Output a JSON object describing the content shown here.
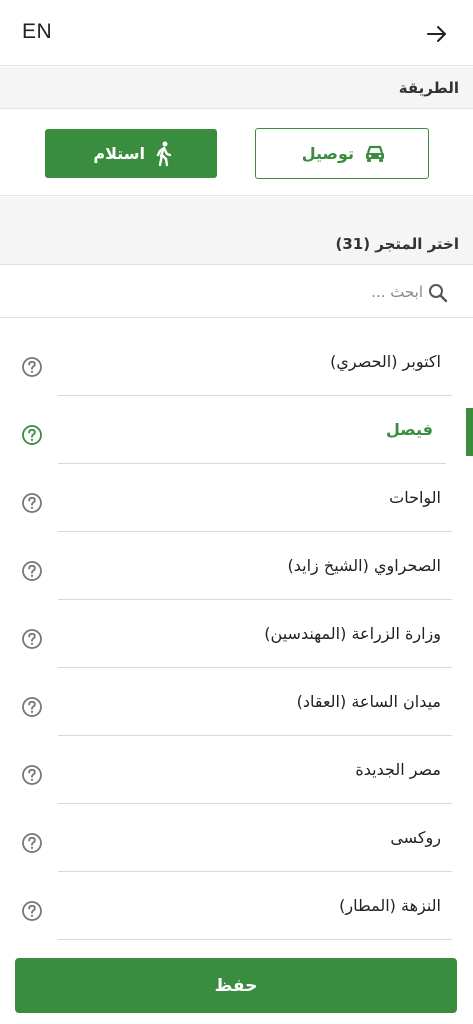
{
  "header": {
    "lang": "EN"
  },
  "method": {
    "title": "الطريقة",
    "delivery_label": "توصيل",
    "pickup_label": "استلام"
  },
  "stores": {
    "title": "اختر المتجر (31)",
    "search_placeholder": "ابحث ...",
    "items": [
      {
        "name": "اكتوبر (الحصري)"
      },
      {
        "name": "فيصل"
      },
      {
        "name": "الواحات"
      },
      {
        "name": "الصحراوي (الشيخ زايد)"
      },
      {
        "name": "وزارة الزراعة (المهندسين)"
      },
      {
        "name": "ميدان الساعة (العقاد)"
      },
      {
        "name": "مصر الجديدة"
      },
      {
        "name": "روكسى"
      },
      {
        "name": "النزهة (المطار)"
      }
    ]
  },
  "footer": {
    "save_label": "حفظ"
  },
  "colors": {
    "accent": "#3a8c3e",
    "icon_gray": "#777777"
  }
}
